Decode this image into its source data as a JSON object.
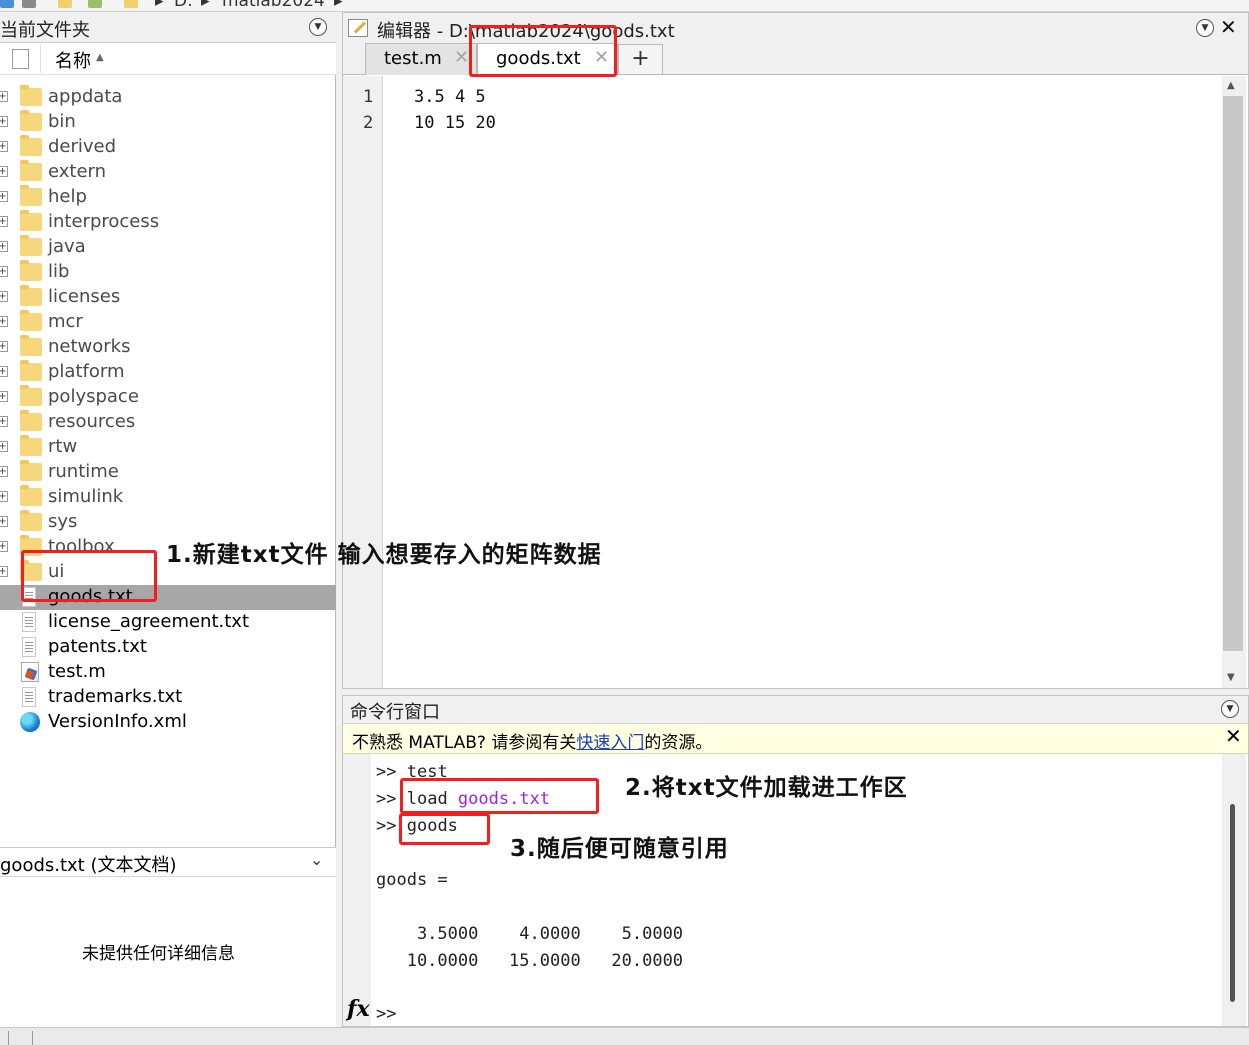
{
  "breadcrumb": [
    "D:",
    "matlab2024"
  ],
  "current_folder": {
    "title": "当前文件夹",
    "column_name": "名称",
    "sort_indicator": "▲",
    "folders": [
      "appdata",
      "bin",
      "derived",
      "extern",
      "help",
      "interprocess",
      "java",
      "lib",
      "licenses",
      "mcr",
      "networks",
      "platform",
      "polyspace",
      "resources",
      "rtw",
      "runtime",
      "simulink",
      "sys",
      "toolbox",
      "ui"
    ],
    "files": [
      {
        "name": "goods.txt",
        "icon": "txt-file-icon",
        "selected": true
      },
      {
        "name": "license_agreement.txt",
        "icon": "txt-file-icon"
      },
      {
        "name": "patents.txt",
        "icon": "txt-file-icon"
      },
      {
        "name": "test.m",
        "icon": "m-file-icon"
      },
      {
        "name": "trademarks.txt",
        "icon": "txt-file-icon"
      },
      {
        "name": "VersionInfo.xml",
        "icon": "xml-file-icon"
      }
    ],
    "detail_title": "goods.txt  (文本文档)",
    "detail_body": "未提供任何详细信息"
  },
  "editor": {
    "title": "编辑器 - D:\\matlab2024\\goods.txt",
    "tabs": [
      {
        "label": "test.m",
        "active": false
      },
      {
        "label": "goods.txt",
        "active": true
      }
    ],
    "add_tab": "+",
    "line_numbers": [
      "1",
      "2"
    ],
    "lines": [
      "3.5 4 5",
      "10 15 20"
    ]
  },
  "command_window": {
    "title": "命令行窗口",
    "notice_prefix": "不熟悉 MATLAB? 请参阅有关",
    "notice_link": "快速入门",
    "notice_suffix": "的资源。",
    "prompt": ">>",
    "cmd1": "test",
    "cmd2_kw": "load ",
    "cmd2_arg": "goods.txt",
    "cmd3": "goods",
    "output_name": "goods =",
    "row1": "    3.5000    4.0000    5.0000",
    "row2": "   10.0000   15.0000   20.0000",
    "fx": "fx",
    "current_prompt": ">>"
  },
  "annotations": {
    "note1": "1.新建txt文件 输入想要存入的矩阵数据",
    "note2": "2.将txt文件加载进工作区",
    "note3": "3.随后便可随意引用"
  },
  "colors": {
    "annotation_box": "#f21f1f",
    "string_literal": "#a020f0",
    "link": "#1a3ec7",
    "notice_bg": "#ffffe1",
    "selection": "#a7a7a7"
  }
}
